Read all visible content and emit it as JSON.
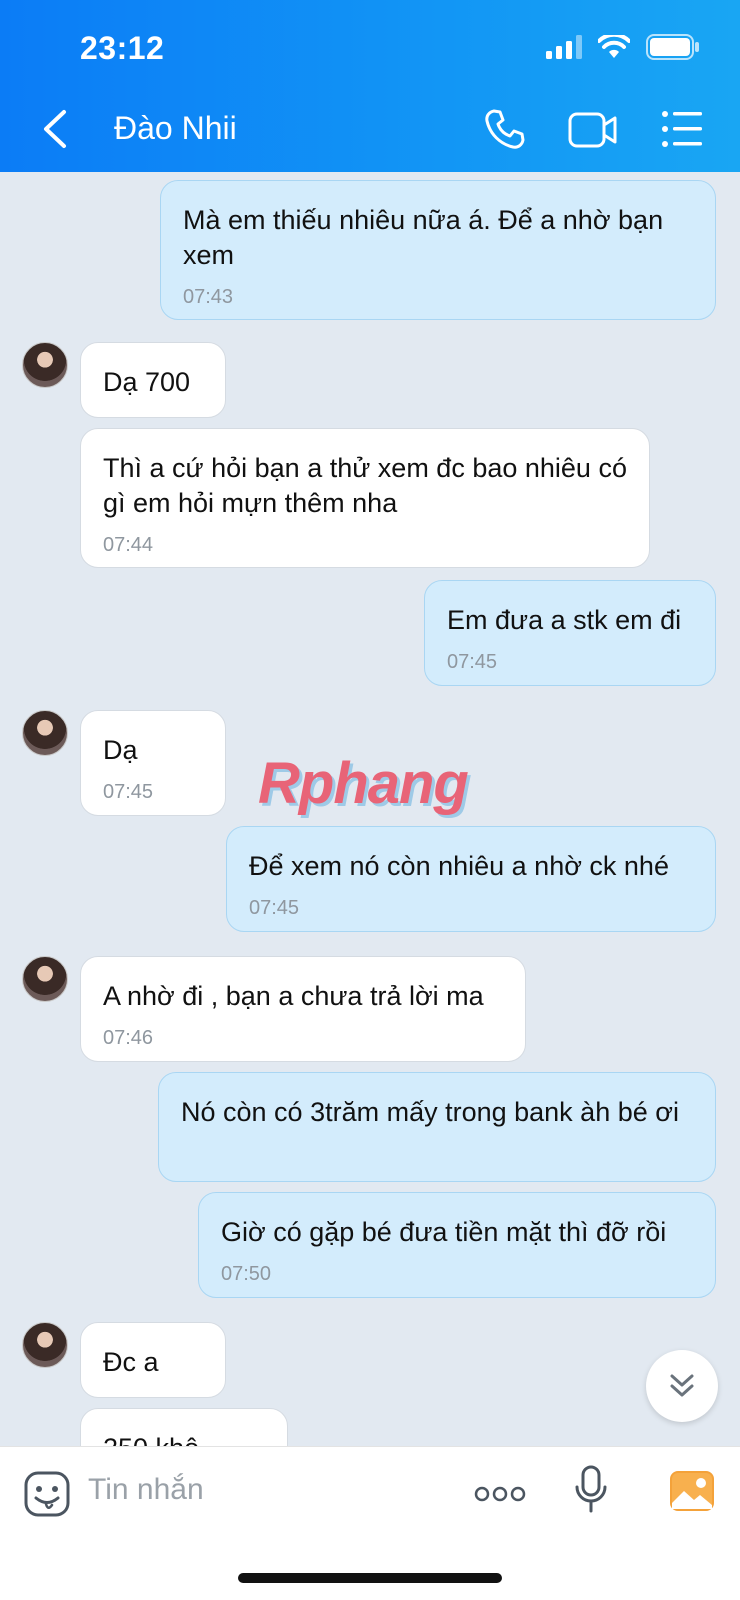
{
  "status": {
    "time": "23:12"
  },
  "nav": {
    "title": "Đào Nhii"
  },
  "messages": [
    {
      "from": "me",
      "text": "Mà em thiếu nhiêu nữa á. Để a nhờ bạn xem",
      "time": "07:43"
    },
    {
      "from": "them",
      "text": "Dạ 700",
      "time": ""
    },
    {
      "from": "them",
      "text": "Thì a cứ hỏi bạn a thử xem đc bao nhiêu có gì em hỏi mựn thêm nha",
      "time": "07:44"
    },
    {
      "from": "me",
      "text": "Em đưa a stk em đi",
      "time": "07:45"
    },
    {
      "from": "them",
      "text": "Dạ",
      "time": "07:45"
    },
    {
      "from": "me",
      "text": "Để xem nó còn nhiêu a nhờ ck nhé",
      "time": "07:45"
    },
    {
      "from": "them",
      "text": "A nhờ đi , bạn a chưa trả lời ma",
      "time": "07:46"
    },
    {
      "from": "me",
      "text": "Nó còn có 3trăm mấy trong bank àh bé ơi",
      "time": ""
    },
    {
      "from": "me",
      "text": "Giờ có gặp bé đưa tiền mặt thì đỡ rồi",
      "time": "07:50"
    },
    {
      "from": "them",
      "text": "Đc a",
      "time": ""
    },
    {
      "from": "them",
      "text": "250 khô...",
      "time": ""
    }
  ],
  "watermark": "Rphang",
  "input": {
    "placeholder": "Tin nhắn"
  },
  "colors": {
    "header": "#1296f5",
    "my_bubble": "#d3ecfc",
    "their_bubble": "#ffffff",
    "background": "#e2e9f1"
  }
}
